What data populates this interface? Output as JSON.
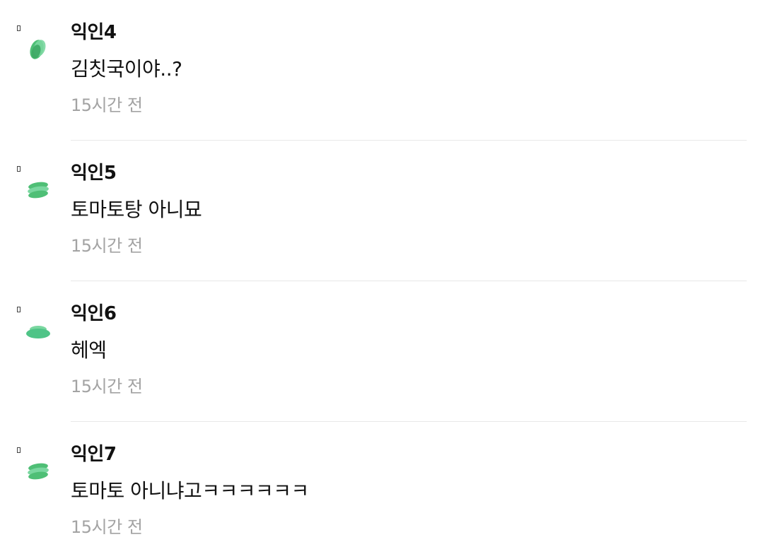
{
  "comments": [
    {
      "author": "익인4",
      "text": "김칫국이야..?",
      "time": "15시간 전",
      "avatar_icon": "green-leaf-icon"
    },
    {
      "author": "익인5",
      "text": "토마토탕 아니묘",
      "time": "15시간 전",
      "avatar_icon": "green-stack-icon"
    },
    {
      "author": "익인6",
      "text": "헤엑",
      "time": "15시간 전",
      "avatar_icon": "green-disc-icon"
    },
    {
      "author": "익인7",
      "text": "토마토 아니냐고ㅋㅋㅋㅋㅋㅋ",
      "time": "15시간 전",
      "avatar_icon": "green-stack-icon"
    }
  ],
  "colors": {
    "avatar_green": "#4fbf76",
    "avatar_green_light": "#7ad7a0",
    "meta_gray": "#a3a3a3",
    "divider": "#e8e8e8"
  }
}
